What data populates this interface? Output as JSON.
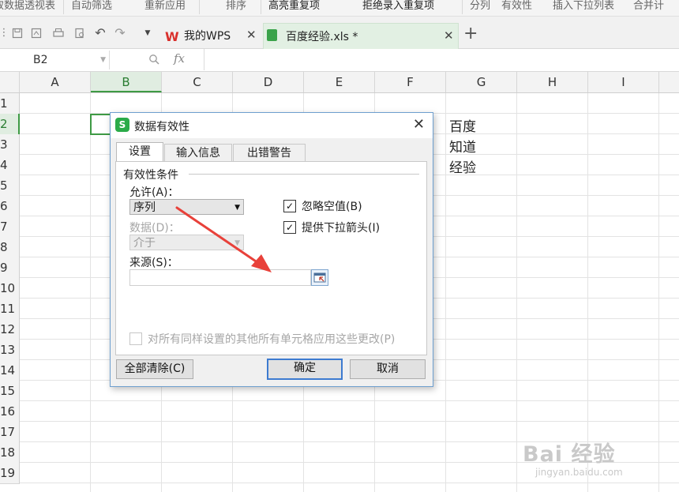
{
  "ribbon": {
    "items": [
      "取数据透视表",
      "自动筛选",
      "重新应用",
      "排序",
      "高亮重复项",
      "拒绝录入重复项",
      "分列",
      "有效性",
      "插入下拉列表",
      "合并计"
    ]
  },
  "tabs": [
    {
      "label": "我的WPS"
    },
    {
      "label": "百度经验.xls *"
    }
  ],
  "new_tab": "+",
  "formula_bar": {
    "cell_ref": "B2",
    "fx": "fx",
    "value": ""
  },
  "sheet": {
    "columns": [
      "A",
      "B",
      "C",
      "D",
      "E",
      "F",
      "G",
      "H",
      "I"
    ],
    "selected_column": "B",
    "rows": [
      "1",
      "2",
      "3",
      "4",
      "5",
      "6",
      "7",
      "8",
      "9",
      "10",
      "11",
      "12",
      "13",
      "14",
      "15",
      "16",
      "17",
      "18",
      "19"
    ],
    "selected_row": "2",
    "cells": [
      {
        "ref": "G2",
        "value": "百度"
      },
      {
        "ref": "G3",
        "value": "知道"
      },
      {
        "ref": "G4",
        "value": "经验"
      }
    ]
  },
  "dialog": {
    "title": "数据有效性",
    "tabs": [
      "设置",
      "输入信息",
      "出错警告"
    ],
    "active_tab": "设置",
    "group_label": "有效性条件",
    "allow_label": "允许(A)：",
    "allow_value": "序列",
    "data_label": "数据(D)：",
    "data_value": "介于",
    "source_label": "来源(S)：",
    "source_value": "",
    "ignore_blank": {
      "label": "忽略空值(B)",
      "checked": true
    },
    "dropdown_arrow": {
      "label": "提供下拉箭头(I)",
      "checked": true
    },
    "apply_all": {
      "label": "对所有同样设置的其他所有单元格应用这些更改(P)",
      "checked": false
    },
    "clear_all_label": "全部清除(C)",
    "ok_label": "确定",
    "cancel_label": "取消"
  },
  "annotation": {
    "color": "#e8413a"
  },
  "watermark": {
    "main": "Bai 经验",
    "sub": "jingyan.baidu.com"
  }
}
